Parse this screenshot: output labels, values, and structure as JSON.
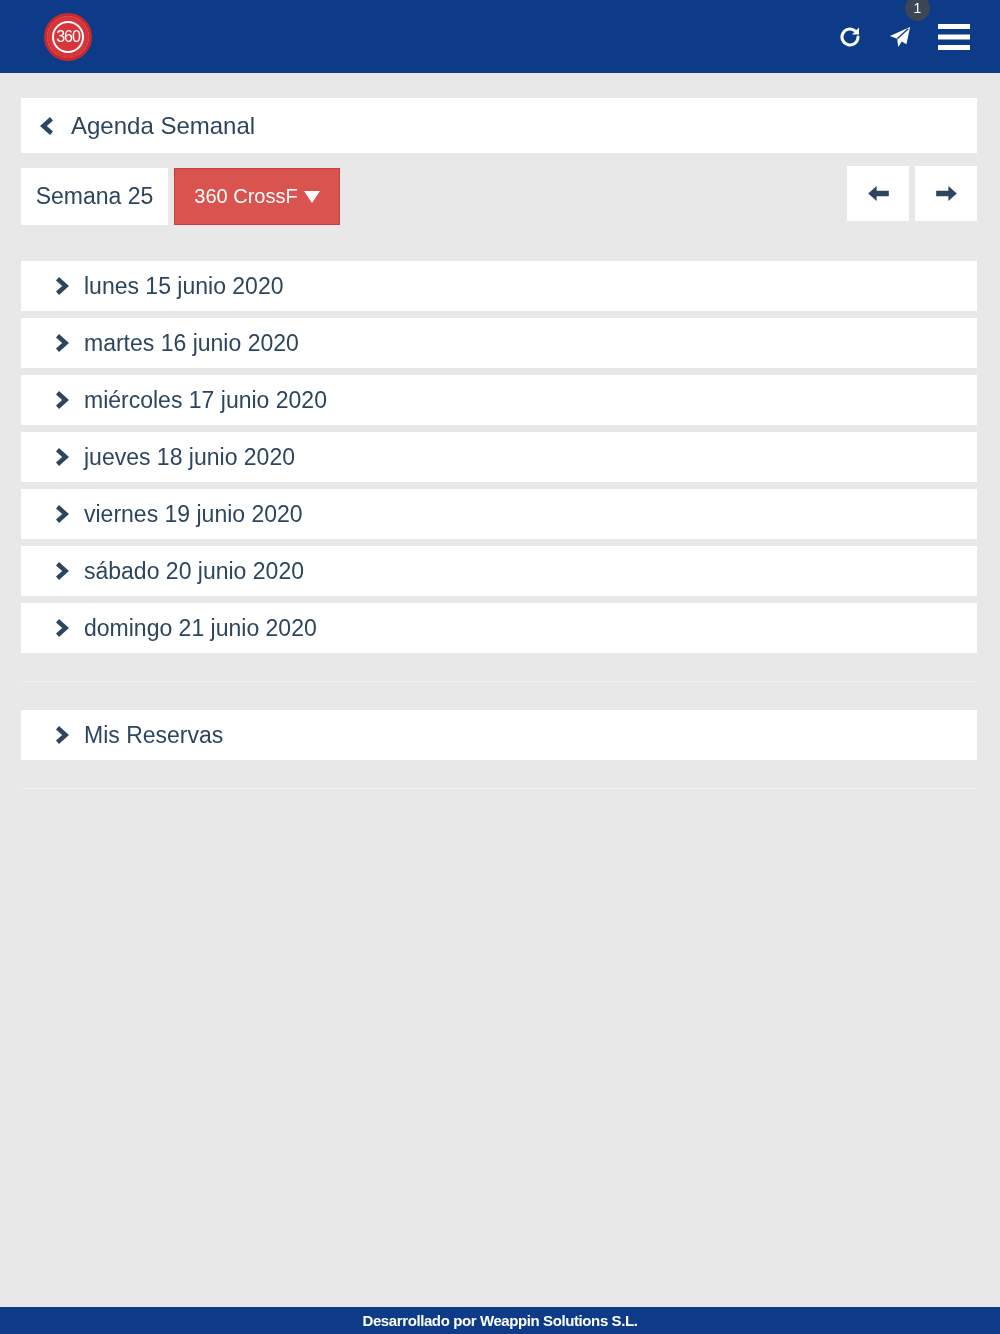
{
  "header": {
    "logo_text": "360",
    "notification_count": "1"
  },
  "page_title": "Agenda Semanal",
  "week": {
    "label": "Semana 25",
    "selector": "360 CrossF"
  },
  "days": [
    {
      "label": "lunes 15 junio 2020",
      "expanded": false
    },
    {
      "label": "martes 16 junio 2020",
      "expanded": false
    },
    {
      "label": "miércoles 17 junio 2020",
      "expanded": false
    },
    {
      "label": "jueves 18 junio 2020",
      "expanded": false
    },
    {
      "label": "viernes 19 junio 2020",
      "expanded": false
    },
    {
      "label": "sábado 20 junio 2020",
      "expanded": false
    },
    {
      "label": "domingo 21 junio 2020",
      "expanded": false
    }
  ],
  "links": [
    {
      "label": "Mis Reservas",
      "expanded": false
    }
  ],
  "footer": "Desarrollado por Weappin Solutions S.L."
}
